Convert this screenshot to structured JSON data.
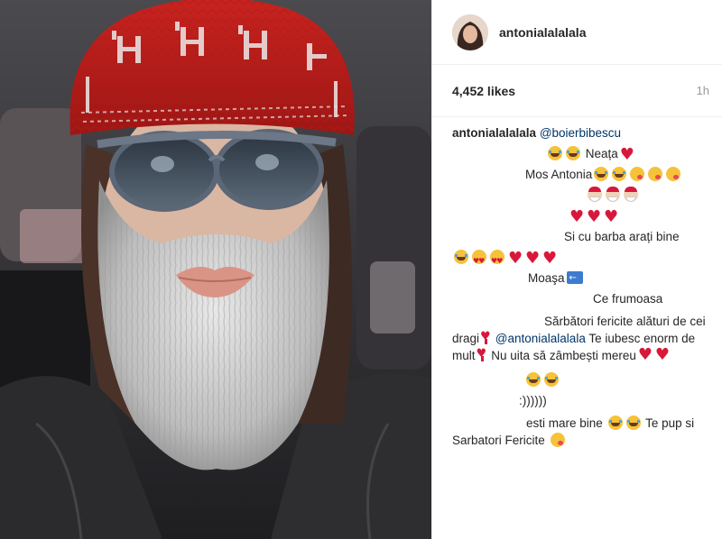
{
  "post": {
    "username": "antonialalalala",
    "likes": "4,452 likes",
    "time": "1h"
  },
  "caption": {
    "author": "antonialalalala",
    "mention": "@boierbibescu",
    "lines": [
      "Neața",
      "Mos Antonia",
      "Si cu barba arați bine",
      "Moaşa",
      "Ce frumoasa",
      "Sărbători fericite alături de cei dragi",
      "@antonialalalala",
      "Te iubesc enorm de mult",
      "Nu uita să zâmbești mereu",
      ":))))))",
      "esti mare bine",
      "Te pup si Sarbatori Fericite"
    ]
  },
  "icons": {
    "joy": "face-with-tears-of-joy-icon",
    "heart": "red-heart-icon",
    "yum": "face-savoring-food-icon",
    "santa": "santa-claus-icon",
    "love": "heart-eyes-icon",
    "exclamation": "heavy-heart-exclamation-icon",
    "back": "back-arrow-icon"
  },
  "colors": {
    "link": "#003569",
    "text": "#262626",
    "muted": "#999999",
    "heart": "#d8183a"
  }
}
